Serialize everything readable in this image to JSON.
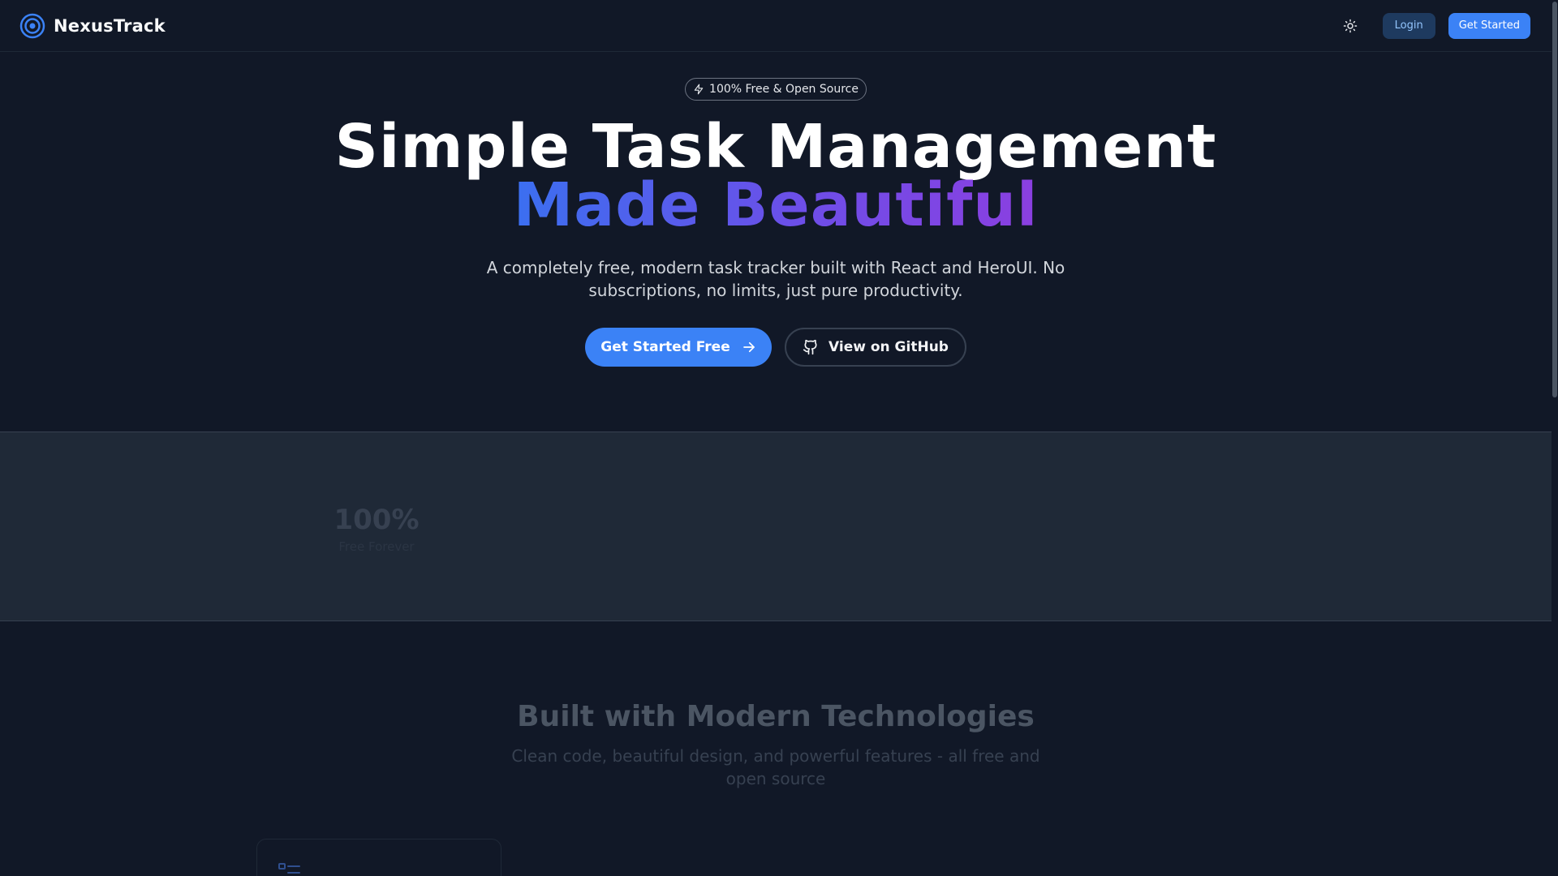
{
  "header": {
    "brand_name": "NexusTrack",
    "login_label": "Login",
    "get_started_label": "Get Started"
  },
  "hero": {
    "badge_text": "100% Free & Open Source",
    "title_line1": "Simple Task Management",
    "title_line2": "Made Beautiful",
    "subtitle": "A completely free, modern task tracker built with React and HeroUI. No subscriptions, no limits, just pure productivity.",
    "primary_button": "Get Started Free",
    "secondary_button": "View on GitHub"
  },
  "stats": {
    "items": [
      {
        "value": "100%",
        "label": "Free Forever"
      }
    ]
  },
  "technologies": {
    "title": "Built with Modern Technologies",
    "subtitle": "Clean code, beautiful design, and powerful features - all free and open source"
  },
  "colors": {
    "background": "#111827",
    "accent": "#3b82f6",
    "gradient_start": "#3b6ff0",
    "gradient_end": "#8b3fe0",
    "stats_background": "#1f2937"
  },
  "icons": {
    "logo": "target-icon",
    "theme": "sun-icon",
    "badge": "lightning-icon",
    "primary_button": "arrow-right-icon",
    "secondary_button": "github-icon",
    "card": "list-icon"
  }
}
